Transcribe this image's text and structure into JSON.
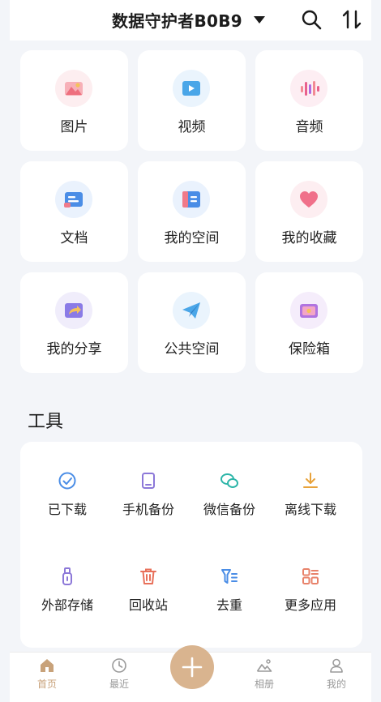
{
  "header": {
    "title": "数据守护者B0B9",
    "dropdown_icon": "caret-down-icon",
    "search_icon": "search-icon",
    "sort_icon": "sort-icon"
  },
  "categories": [
    {
      "label": "图片",
      "icon": "image-icon",
      "color": "#f28a94"
    },
    {
      "label": "视频",
      "icon": "video-icon",
      "color": "#4aa6e8"
    },
    {
      "label": "音频",
      "icon": "audio-icon",
      "color": "#e9608c"
    },
    {
      "label": "文档",
      "icon": "document-icon",
      "color": "#4a8de6"
    },
    {
      "label": "我的空间",
      "icon": "my-space-icon",
      "color": "#4a8de6"
    },
    {
      "label": "我的收藏",
      "icon": "favorite-icon",
      "color": "#f0708a"
    },
    {
      "label": "我的分享",
      "icon": "share-icon",
      "color": "#8a7be6"
    },
    {
      "label": "公共空间",
      "icon": "paper-plane-icon",
      "color": "#4aa6e8"
    },
    {
      "label": "保险箱",
      "icon": "safe-icon",
      "color": "#b074e0"
    }
  ],
  "tools_section": {
    "title": "工具",
    "items": [
      {
        "label": "已下载",
        "icon": "downloaded-icon",
        "color": "#4a8de6"
      },
      {
        "label": "手机备份",
        "icon": "phone-backup-icon",
        "color": "#8c78d8"
      },
      {
        "label": "微信备份",
        "icon": "wechat-backup-icon",
        "color": "#2cb5a8"
      },
      {
        "label": "离线下载",
        "icon": "offline-download-icon",
        "color": "#e8a33c"
      },
      {
        "label": "外部存储",
        "icon": "usb-storage-icon",
        "color": "#8c78d8"
      },
      {
        "label": "回收站",
        "icon": "recycle-bin-icon",
        "color": "#e8705a"
      },
      {
        "label": "去重",
        "icon": "dedupe-icon",
        "color": "#4a8de6"
      },
      {
        "label": "更多应用",
        "icon": "more-apps-icon",
        "color": "#e8826a"
      }
    ]
  },
  "tabbar": {
    "tabs": [
      {
        "label": "首页",
        "icon": "home-icon",
        "active": true
      },
      {
        "label": "最近",
        "icon": "clock-icon",
        "active": false
      },
      {
        "label": "相册",
        "icon": "album-icon",
        "active": false
      },
      {
        "label": "我的",
        "icon": "profile-icon",
        "active": false
      }
    ],
    "fab_icon": "plus-icon",
    "accent_color": "#d9b48f"
  }
}
